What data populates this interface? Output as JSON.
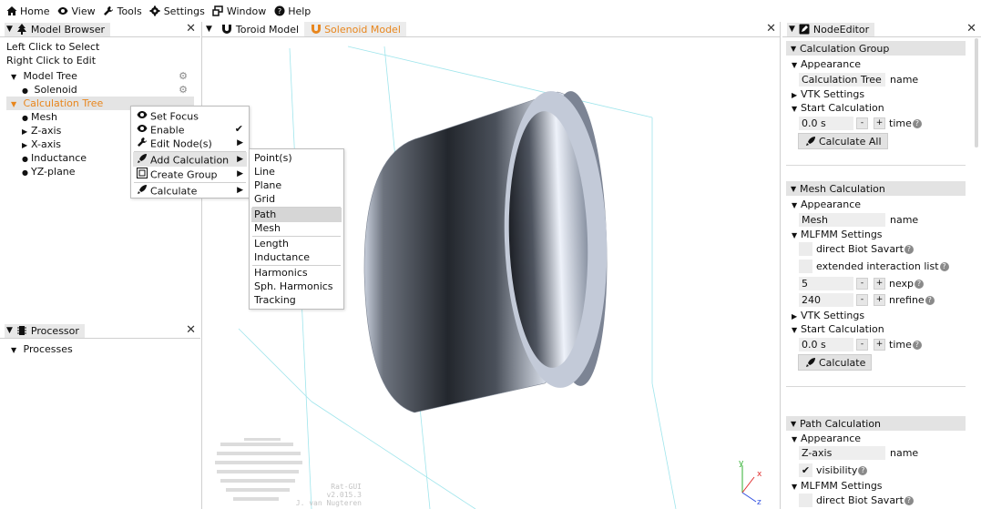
{
  "menubar": [
    {
      "label": "Home",
      "icon": "home-icon"
    },
    {
      "label": "View",
      "icon": "eye-icon"
    },
    {
      "label": "Tools",
      "icon": "wrench-icon"
    },
    {
      "label": "Settings",
      "icon": "gear-icon"
    },
    {
      "label": "Window",
      "icon": "window-icon"
    },
    {
      "label": "Help",
      "icon": "help-icon"
    }
  ],
  "model_browser": {
    "title": "Model Browser",
    "hint1": "Left Click to Select",
    "hint2": "Right Click to Edit",
    "model_tree": "Model Tree",
    "solenoid": "Solenoid",
    "calc_tree": "Calculation Tree",
    "children": [
      "Mesh",
      "Z-axis",
      "X-axis",
      "Inductance",
      "YZ-plane"
    ]
  },
  "context_menu": {
    "items": [
      "Set Focus",
      "Enable",
      "Edit Node(s)",
      "Add Calculation",
      "Create Group",
      "Calculate"
    ],
    "submenu": [
      "Point(s)",
      "Line",
      "Plane",
      "Grid",
      "Path",
      "Mesh",
      "Length",
      "Inductance",
      "Harmonics",
      "Sph. Harmonics",
      "Tracking"
    ]
  },
  "processor": {
    "title": "Processor",
    "processes": "Processes"
  },
  "viewport": {
    "tabs": [
      "Toroid Model",
      "Solenoid Model"
    ],
    "active_tab": 1,
    "watermark1": "Rat-GUI",
    "watermark2": "v2.015.3",
    "watermark3": "J. van Nugteren",
    "axes": {
      "x": "x",
      "y": "y",
      "z": "z"
    }
  },
  "node_editor": {
    "title": "NodeEditor",
    "calc_group": {
      "header": "Calculation Group",
      "appearance": "Appearance",
      "name_value": "Calculation Tree",
      "name_label": "name",
      "vtk": "VTK Settings",
      "start": "Start Calculation",
      "time_value": "0.0 s",
      "time_label": "time",
      "button": "Calculate All"
    },
    "mesh_calc": {
      "header": "Mesh Calculation",
      "appearance": "Appearance",
      "name_value": "Mesh",
      "name_label": "name",
      "mlfmm": "MLFMM Settings",
      "direct": "direct Biot Savart",
      "extended": "extended interaction list",
      "nexp_value": "5",
      "nexp_label": "nexp",
      "nrefine_value": "240",
      "nrefine_label": "nrefine",
      "vtk": "VTK Settings",
      "start": "Start Calculation",
      "time_value": "0.0 s",
      "time_label": "time",
      "button": "Calculate"
    },
    "path_calc": {
      "header": "Path Calculation",
      "appearance": "Appearance",
      "name_value": "Z-axis",
      "name_label": "name",
      "visibility": "visibility",
      "mlfmm": "MLFMM Settings",
      "direct": "direct Biot Savart"
    }
  },
  "colors": {
    "accent": "#e8861d",
    "axis_x": "#e03030",
    "axis_y": "#30b030",
    "axis_z": "#3050e0"
  }
}
